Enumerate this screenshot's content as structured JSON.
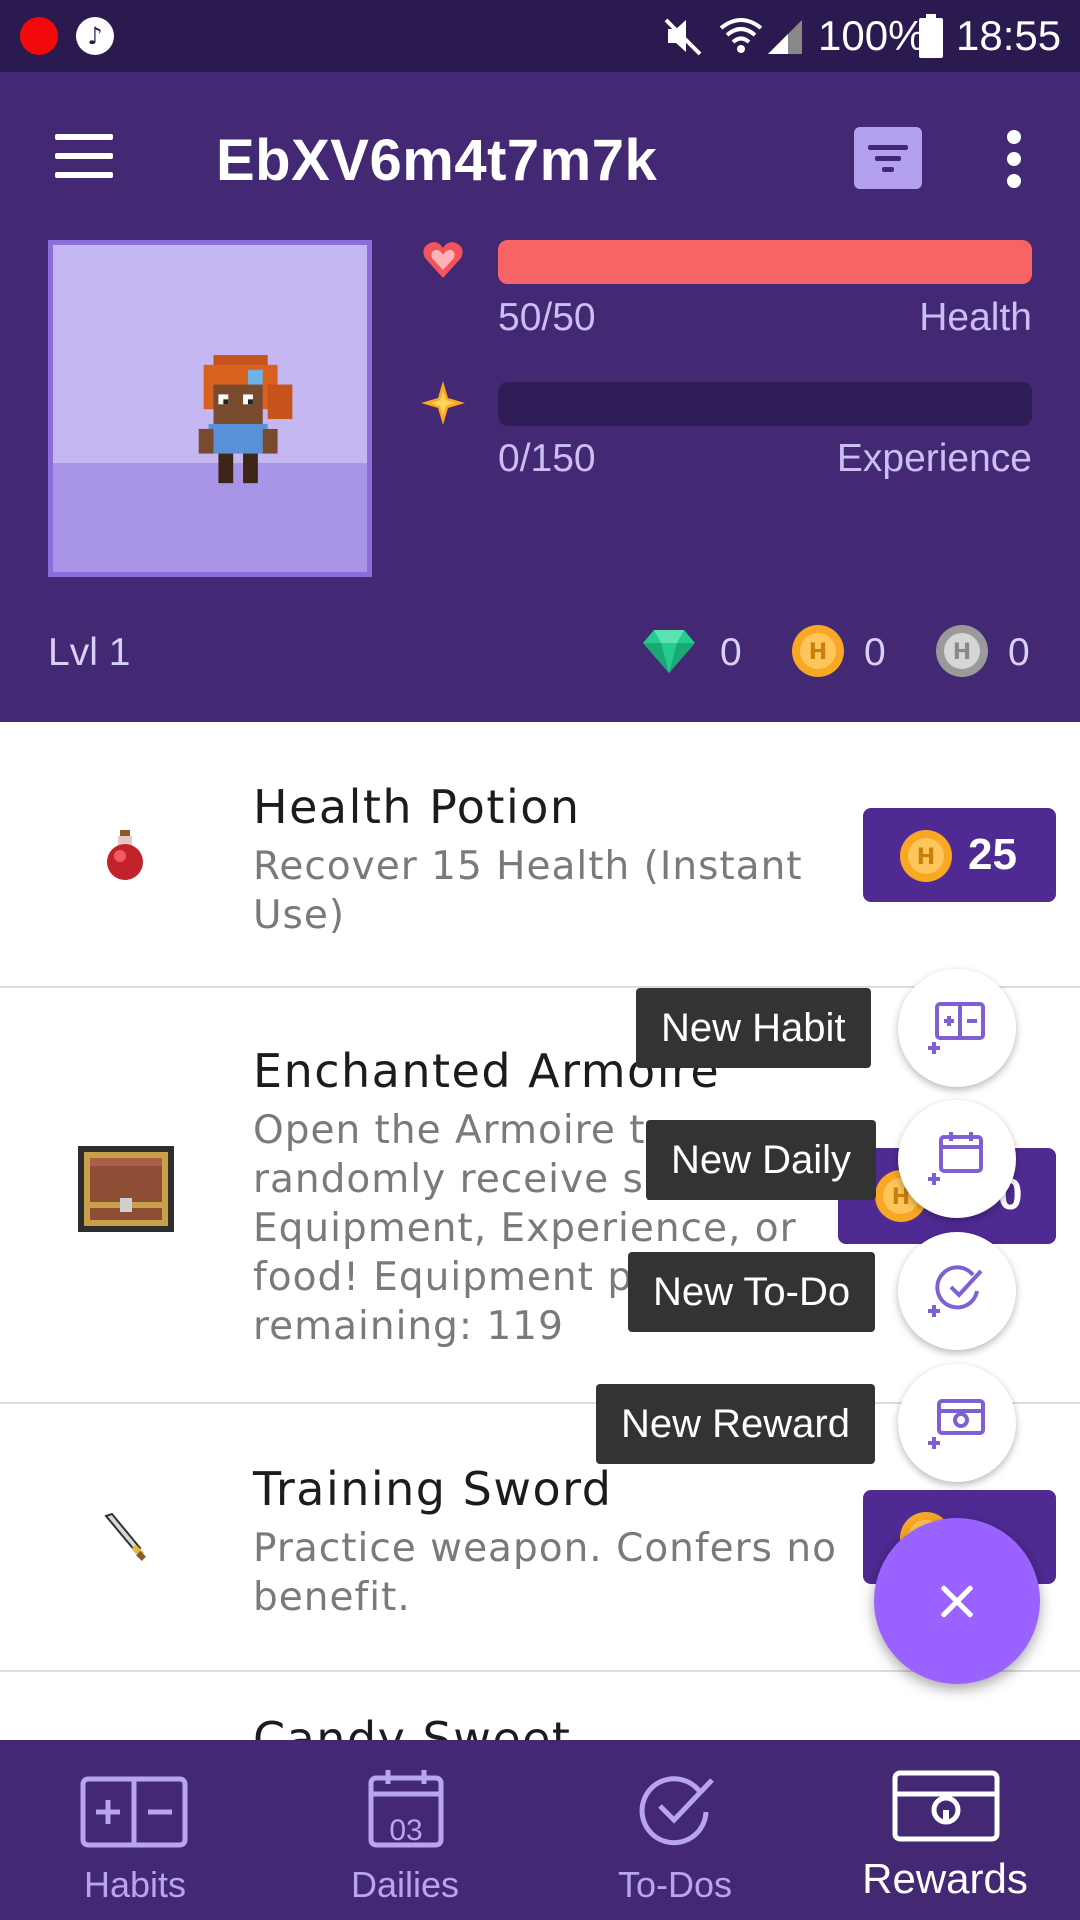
{
  "status_bar": {
    "battery": "100%",
    "time": "18:55",
    "icons": [
      "record-icon",
      "music-icon",
      "mute-icon",
      "wifi-icon",
      "signal-icon",
      "battery-icon"
    ]
  },
  "header": {
    "title": "EbXV6m4t7m7k",
    "health": {
      "value": "50/50",
      "label": "Health",
      "fraction": 1.0,
      "color": "#f86466"
    },
    "experience": {
      "value": "0/150",
      "label": "Experience",
      "fraction": 0.0,
      "color": "#2d1c55"
    },
    "level": "Lvl 1",
    "gems": "0",
    "gold": "0",
    "hourglasses": "0"
  },
  "rewards": [
    {
      "title": "Health Potion",
      "notes": [
        "Recover 15 Health (Instant",
        "Use)"
      ],
      "price": "25",
      "icon": "health-potion-icon"
    },
    {
      "title": "Enchanted Armoire",
      "notes": [
        "Open the Armoire to",
        "randomly receive sp",
        "Equipment, Experience, or",
        "food! Equipment pi",
        "remaining: 119"
      ],
      "price": "0",
      "icon": "armoire-icon"
    },
    {
      "title": "Training Sword",
      "notes": [
        "Practice weapon. Confers no",
        "benefit."
      ],
      "price": "",
      "icon": "sword-icon"
    },
    {
      "title": "Candy Sweet",
      "notes": [],
      "price": "",
      "icon": ""
    }
  ],
  "fab_menu": {
    "new_habit": "New Habit",
    "new_daily": "New Daily",
    "new_todo": "New To-Do",
    "new_reward": "New Reward"
  },
  "nav": {
    "habits": "Habits",
    "dailies": "Dailies",
    "dailies_day": "03",
    "todos": "To-Dos",
    "rewards": "Rewards",
    "active": "rewards"
  },
  "colors": {
    "header": "#432874",
    "status_bar": "#2a1a4f",
    "accent": "#9a62ff",
    "price_button": "#4f2a93"
  }
}
